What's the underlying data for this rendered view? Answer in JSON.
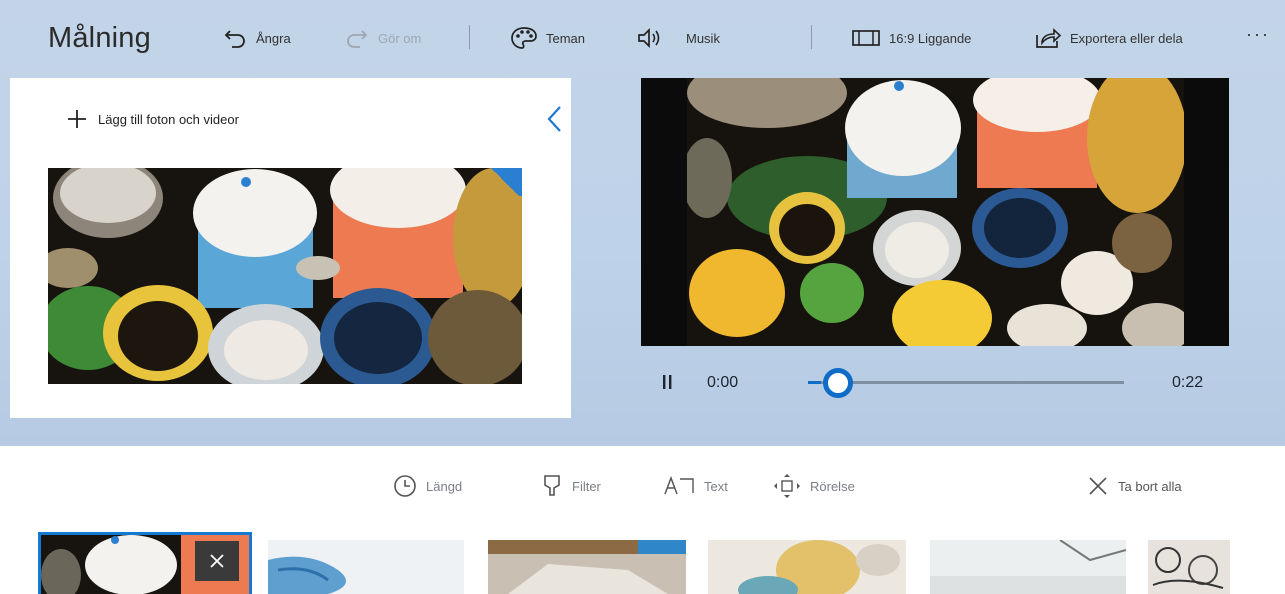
{
  "app": {
    "title": "Målning"
  },
  "toolbar": {
    "undo": {
      "label": "Ångra",
      "icon": "undo-icon"
    },
    "redo": {
      "label": "Gör om",
      "icon": "redo-icon"
    },
    "themes": {
      "label": "Teman",
      "icon": "palette-icon"
    },
    "music": {
      "label": "Musik",
      "icon": "speaker-icon"
    },
    "aspect": {
      "label": "16:9 Liggande",
      "icon": "aspect-ratio-icon"
    },
    "export": {
      "label": "Exportera eller dela",
      "icon": "share-icon"
    },
    "more": {
      "label": "···",
      "icon": "more-icon"
    }
  },
  "library": {
    "add_label": "Lägg till foton och videor",
    "collapse_icon": "chevron-left-icon"
  },
  "playback": {
    "current_time": "0:00",
    "total_time": "0:22",
    "progress": 0.04,
    "play_state": "playing"
  },
  "storyboard": {
    "tools": [
      {
        "label": "Längd",
        "icon": "clock-icon"
      },
      {
        "label": "Filter",
        "icon": "filter-icon"
      },
      {
        "label": "Text",
        "icon": "text-icon"
      },
      {
        "label": "Rörelse",
        "icon": "motion-icon"
      }
    ],
    "remove_all": {
      "label": "Ta bort alla",
      "icon": "close-icon"
    },
    "clip_count_visible": 6,
    "selected_clip": 0
  },
  "colors": {
    "accent": "#0f6cc7",
    "toolbar_bg": "#c3d4e8",
    "panel_bg": "#ffffff",
    "muted_text": "#7a7f86"
  }
}
